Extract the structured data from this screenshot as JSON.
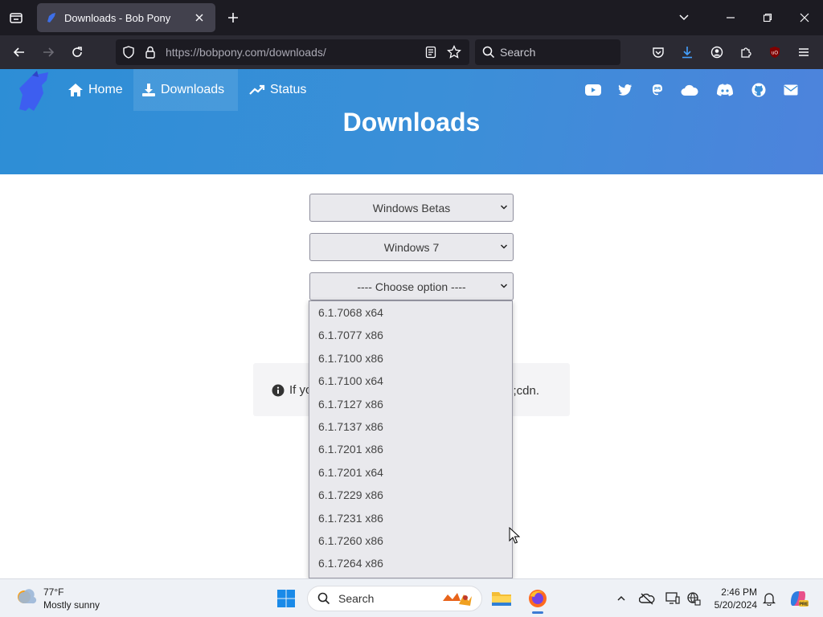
{
  "browser": {
    "tab_title": "Downloads - Bob Pony",
    "url_host": "https://bobpony.com",
    "url_path": "/downloads/",
    "search_placeholder": "Search"
  },
  "site": {
    "nav": [
      {
        "label": "Home"
      },
      {
        "label": "Downloads"
      },
      {
        "label": "Status"
      }
    ],
    "page_title": "Downloads"
  },
  "form": {
    "category_select": "Windows Betas",
    "version_select": "Windows 7",
    "build_select": "---- Choose option ----",
    "build_options": [
      "6.1.7068 x64",
      "6.1.7077 x86",
      "6.1.7100 x86",
      "6.1.7100 x64",
      "6.1.7127 x86",
      "6.1.7137 x86",
      "6.1.7201 x86",
      "6.1.7201 x64",
      "6.1.7229 x86",
      "6.1.7231 x86",
      "6.1.7260 x86",
      "6.1.7264 x86"
    ]
  },
  "info": {
    "text_left": "If yo",
    "text_right": ";cdn."
  },
  "taskbar": {
    "weather_temp": "77°F",
    "weather_desc": "Mostly sunny",
    "search_label": "Search",
    "time": "2:46 PM",
    "date": "5/20/2024"
  },
  "colors": {
    "header_blue": "#3b8fd8",
    "select_bg": "#e9e9ed",
    "tab_bg": "#42414d"
  }
}
